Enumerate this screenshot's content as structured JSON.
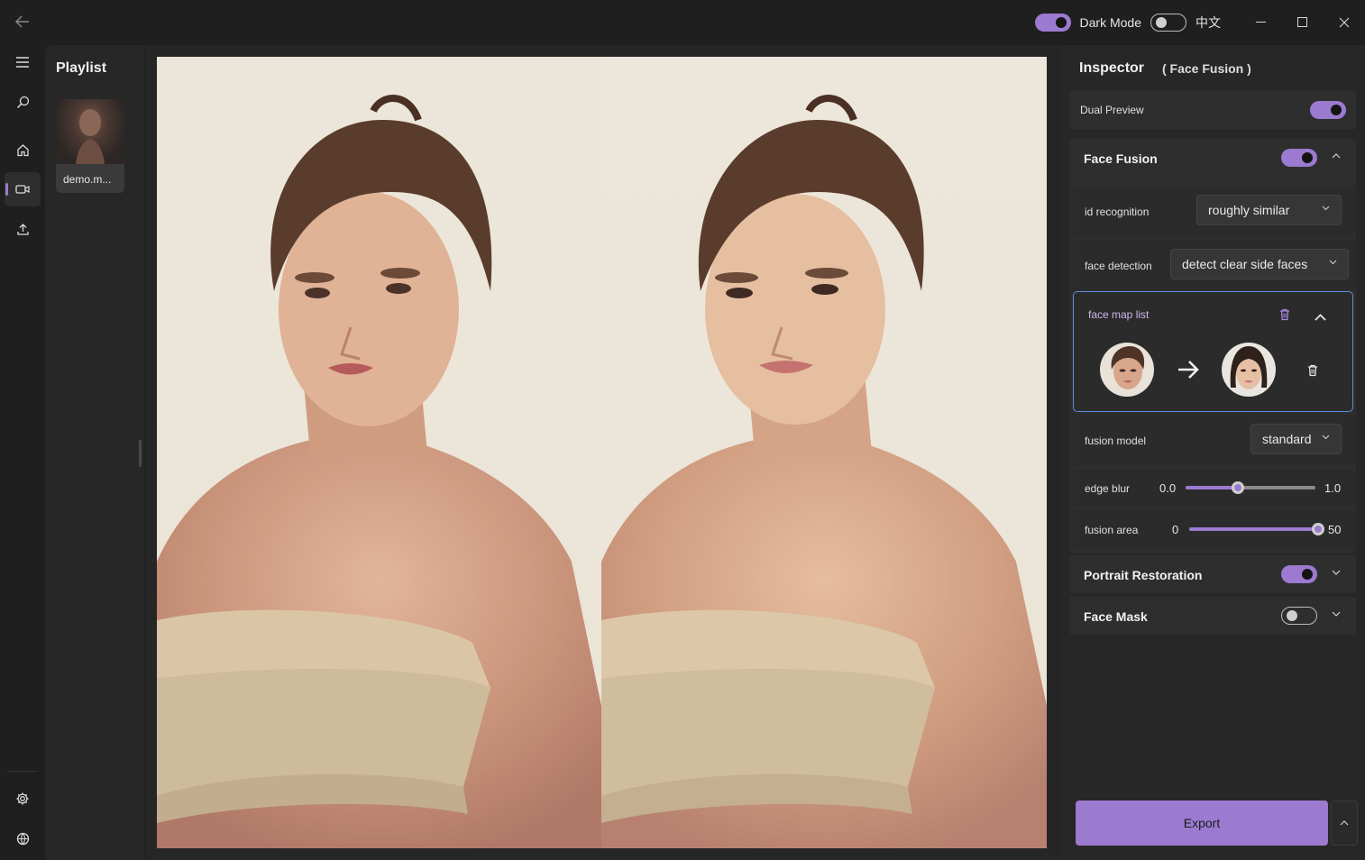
{
  "titlebar": {
    "dark_mode_label": "Dark Mode",
    "dark_mode_on": true,
    "language_label": "中文",
    "language_on": false
  },
  "nav": {
    "icons": [
      "menu-icon",
      "search-icon",
      "home-icon",
      "video-icon",
      "upload-icon",
      "gear-icon",
      "globe-icon"
    ],
    "active": "video-icon"
  },
  "playlist": {
    "title": "Playlist",
    "items": [
      {
        "name": "demo.m..."
      }
    ]
  },
  "inspector": {
    "title": "Inspector",
    "subtitle": "( Face Fusion )",
    "dual_preview": {
      "label": "Dual Preview",
      "on": true
    },
    "face_fusion": {
      "label": "Face Fusion",
      "on": true,
      "id_recognition": {
        "label": "id recognition",
        "value": "roughly similar"
      },
      "face_detection": {
        "label": "face detection",
        "value": "detect clear side faces"
      },
      "face_map_list": {
        "label": "face map list"
      },
      "fusion_model": {
        "label": "fusion model",
        "value": "standard"
      },
      "edge_blur": {
        "label": "edge blur",
        "min": "0.0",
        "max": "1.0",
        "value_fraction": 0.4
      },
      "fusion_area": {
        "label": "fusion area",
        "min": "0",
        "max": "50",
        "value_fraction": 1.0
      }
    },
    "portrait_restoration": {
      "label": "Portrait Restoration",
      "on": true
    },
    "face_mask": {
      "label": "Face Mask",
      "on": false
    },
    "export_label": "Export"
  },
  "colors": {
    "accent": "#9b7ad0",
    "focus_border": "#5a8fd6",
    "background": "#1f1f1f",
    "panel": "#272727"
  }
}
